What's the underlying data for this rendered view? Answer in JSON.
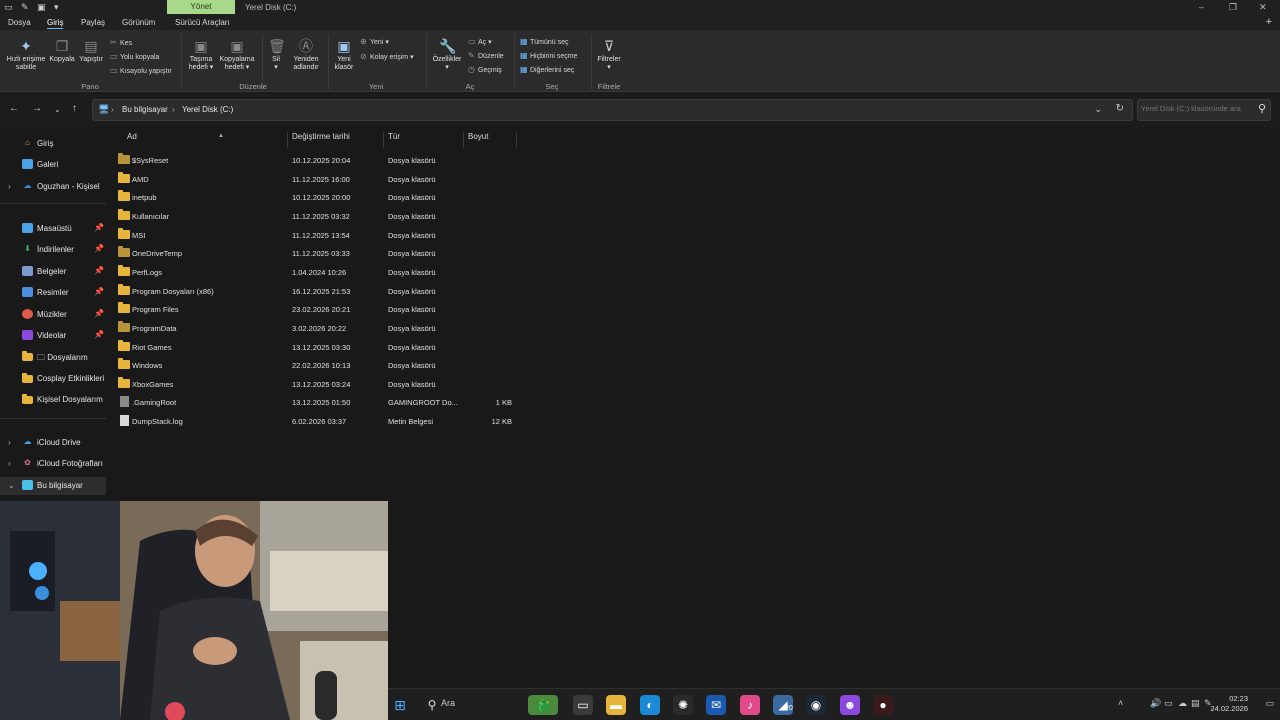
{
  "titlebar": {
    "context_tab": "Yönet",
    "title": "Yerel Disk (C:)",
    "controls": [
      "–",
      "❐",
      "✕"
    ]
  },
  "menu": {
    "tabs": [
      "Dosya",
      "Giriş",
      "Paylaş",
      "Görünüm",
      "Sürücü Araçları"
    ],
    "active": "Giriş"
  },
  "ribbon": {
    "pin": "Hızlı erişime\nsabitle",
    "copy": "Kopyala",
    "paste": "Yapıştır",
    "cut": "Kes",
    "copy_path": "Yolu kopyala",
    "paste_shortcut": "Kısayolu yapıştır",
    "move_to": "Taşıma\nhedefi ▾",
    "copy_to": "Kopyalama\nhedefi ▾",
    "delete": "Sil\n▾",
    "rename": "Yeniden\nadlandır",
    "new_folder": "Yeni\nklasör",
    "new_item": "Yeni ▾",
    "easy_access": "Kolay erişim ▾",
    "properties": "Özellikler\n▾",
    "open": "Aç ▾",
    "edit": "Düzenle",
    "history": "Geçmiş",
    "select_all": "Tümünü seç",
    "select_none": "Hiçbirini seçme",
    "invert_select": "Diğerlerini seç",
    "filters": "Filtreler\n▾",
    "groups": [
      "Pano",
      "Düzenle",
      "Yeni",
      "Aç",
      "Seç",
      "Filtrele"
    ]
  },
  "address": {
    "crumbs": [
      "Bu bilgisayar",
      "Yerel Disk (C:)"
    ],
    "search_placeholder": "Yerel Disk (C:) klasöründe ara"
  },
  "sidebar": {
    "items": [
      {
        "label": "Giriş",
        "icon": "home-icon",
        "color": "#e8a24a"
      },
      {
        "label": "Galeri",
        "icon": "gallery-icon",
        "color": "#4aa3e8"
      },
      {
        "label": "Oguzhan - Kişisel",
        "icon": "cloud-icon",
        "color": "#3b8fe0"
      },
      {
        "label": "Masaüstü",
        "icon": "desktop-icon",
        "color": "#4aa3e8"
      },
      {
        "label": "İndirilenler",
        "icon": "download-icon",
        "color": "#3fb86a"
      },
      {
        "label": "Belgeler",
        "icon": "documents-icon",
        "color": "#7a9ccf"
      },
      {
        "label": "Resimler",
        "icon": "pictures-icon",
        "color": "#4a8fe0"
      },
      {
        "label": "Müzikler",
        "icon": "music-icon",
        "color": "#e05a4a"
      },
      {
        "label": "Videolar",
        "icon": "videos-icon",
        "color": "#8a4ae0"
      },
      {
        "label": "🗀 Dosyalarım",
        "icon": "folder-icon",
        "color": "#e8b53c"
      },
      {
        "label": "Cosplay Etkinlikleri",
        "icon": "folder-icon",
        "color": "#e8b53c"
      },
      {
        "label": "Kişisel Dosyalarım",
        "icon": "folder-icon",
        "color": "#e8b53c"
      },
      {
        "label": "iCloud Drive",
        "icon": "icloud-icon",
        "color": "#4aa3e8"
      },
      {
        "label": "iCloud Fotoğrafları",
        "icon": "icloud-photos-icon",
        "color": "#e06a9a"
      },
      {
        "label": "Bu bilgisayar",
        "icon": "computer-icon",
        "color": "#4ac0e8"
      }
    ]
  },
  "columns": [
    "Ad",
    "Değiştirme tarihi",
    "Tür",
    "Boyut"
  ],
  "files": [
    {
      "name": "$SysReset",
      "date": "10.12.2025 20:04",
      "type": "Dosya klasörü",
      "size": "",
      "kind": "folder-dim"
    },
    {
      "name": "AMD",
      "date": "11.12.2025 16:00",
      "type": "Dosya klasörü",
      "size": "",
      "kind": "folder"
    },
    {
      "name": "inetpub",
      "date": "10.12.2025 20:00",
      "type": "Dosya klasörü",
      "size": "",
      "kind": "folder"
    },
    {
      "name": "Kullanıcılar",
      "date": "11.12.2025 03:32",
      "type": "Dosya klasörü",
      "size": "",
      "kind": "folder"
    },
    {
      "name": "MSI",
      "date": "11.12.2025 13:54",
      "type": "Dosya klasörü",
      "size": "",
      "kind": "folder"
    },
    {
      "name": "OneDriveTemp",
      "date": "11.12.2025 03:33",
      "type": "Dosya klasörü",
      "size": "",
      "kind": "folder-dim"
    },
    {
      "name": "PerfLogs",
      "date": "1.04.2024 10:26",
      "type": "Dosya klasörü",
      "size": "",
      "kind": "folder"
    },
    {
      "name": "Program Dosyaları (x86)",
      "date": "16.12.2025 21:53",
      "type": "Dosya klasörü",
      "size": "",
      "kind": "folder"
    },
    {
      "name": "Program Files",
      "date": "23.02.2026 20:21",
      "type": "Dosya klasörü",
      "size": "",
      "kind": "folder"
    },
    {
      "name": "ProgramData",
      "date": "3.02.2026 20:22",
      "type": "Dosya klasörü",
      "size": "",
      "kind": "folder-dim"
    },
    {
      "name": "Riot Games",
      "date": "13.12.2025 03:30",
      "type": "Dosya klasörü",
      "size": "",
      "kind": "folder"
    },
    {
      "name": "Windows",
      "date": "22.02.2026 10:13",
      "type": "Dosya klasörü",
      "size": "",
      "kind": "folder"
    },
    {
      "name": "XboxGames",
      "date": "13.12.2025 03:24",
      "type": "Dosya klasörü",
      "size": "",
      "kind": "folder"
    },
    {
      "name": ".GamingRoot",
      "date": "13.12.2025 01:50",
      "type": "GAMINGROOT Do...",
      "size": "1 KB",
      "kind": "file-dim"
    },
    {
      "name": "DumpStack.log",
      "date": "6.02.2026 03:37",
      "type": "Metin Belgesi",
      "size": "12 KB",
      "kind": "file"
    }
  ],
  "taskbar": {
    "search_label": "Ara",
    "apps": [
      {
        "icon": "dragon-app-icon",
        "color": "#4a8a3a",
        "glyph": "🐉"
      },
      {
        "icon": "window-app-icon",
        "color": "#3a3a3a",
        "glyph": "▭"
      },
      {
        "icon": "file-explorer-icon",
        "color": "#e8b53c",
        "glyph": "▬"
      },
      {
        "icon": "edge-icon",
        "color": "#1a8ad6",
        "glyph": "◐"
      },
      {
        "icon": "chatgpt-icon",
        "color": "#2a2a2a",
        "glyph": "✺"
      },
      {
        "icon": "mail-icon",
        "color": "#1a5ab0",
        "glyph": "✉"
      },
      {
        "icon": "itunes-icon",
        "color": "#e04a8a",
        "glyph": "♪"
      },
      {
        "icon": "app-20-icon",
        "color": "#3a6aa0",
        "glyph": "◢"
      },
      {
        "icon": "steam-icon",
        "color": "#1b2838",
        "glyph": "◉"
      },
      {
        "icon": "discord-icon",
        "color": "#8a4ae0",
        "glyph": "☻"
      },
      {
        "icon": "obs-icon",
        "color": "#3a1a1a",
        "glyph": "●"
      }
    ],
    "badge": "20",
    "time": "02:23",
    "date": "24.02.2026"
  }
}
